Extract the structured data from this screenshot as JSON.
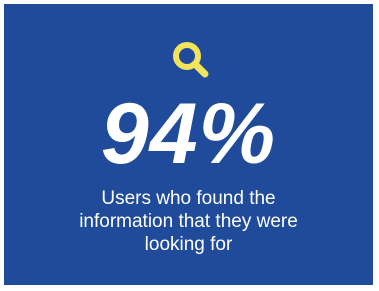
{
  "stat": {
    "value": "94%",
    "description": "Users who found the information that they were looking for"
  },
  "icon": {
    "name": "search-icon",
    "color": "#f1e35a"
  },
  "colors": {
    "background": "#1f4b9a",
    "text": "#ffffff"
  }
}
